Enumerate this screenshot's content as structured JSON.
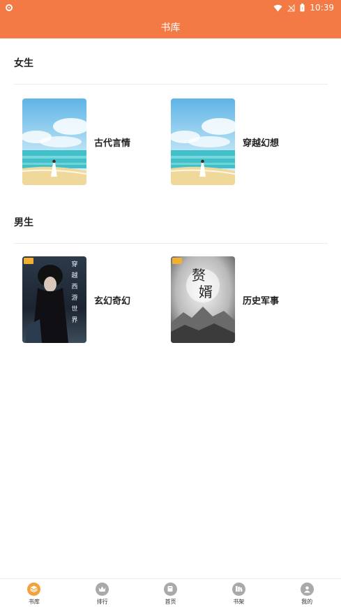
{
  "status_bar": {
    "time": "10:39"
  },
  "header": {
    "title": "书库"
  },
  "sections": [
    {
      "title": "女生",
      "books": [
        {
          "label": "古代言情",
          "cover": "beach-girl-cover"
        },
        {
          "label": "穿越幻想",
          "cover": "beach-girl-cover"
        }
      ]
    },
    {
      "title": "男生",
      "books": [
        {
          "label": "玄幻奇幻",
          "cover": "dark-fantasy-cover",
          "cover_text": "穿越西游世界"
        },
        {
          "label": "历史军事",
          "cover": "ink-mountain-cover",
          "cover_text": "赘婿"
        }
      ]
    }
  ],
  "tabs": [
    {
      "label": "书库",
      "icon": "layers-icon",
      "active": true
    },
    {
      "label": "排行",
      "icon": "crown-icon",
      "active": false
    },
    {
      "label": "首页",
      "icon": "home-book-icon",
      "active": false
    },
    {
      "label": "书架",
      "icon": "bookshelf-icon",
      "active": false
    },
    {
      "label": "我的",
      "icon": "user-icon",
      "active": false
    }
  ],
  "colors": {
    "accent": "#f47a45",
    "tab_active": "#f2a23a",
    "tab_inactive": "#a9a9a9"
  }
}
